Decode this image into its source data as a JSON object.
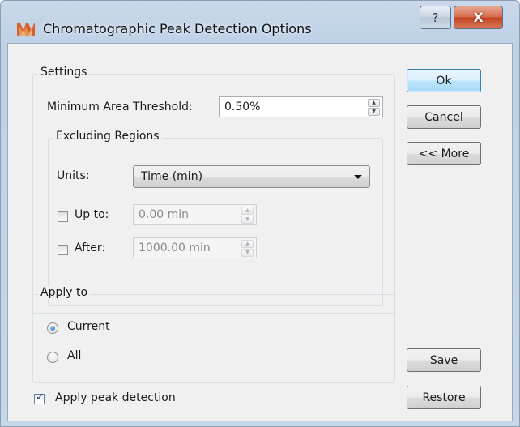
{
  "window": {
    "title": "Chromatographic Peak Detection Options",
    "help_glyph": "?",
    "close_glyph": "X"
  },
  "settings": {
    "group_label": "Settings",
    "min_area_label": "Minimum Area Threshold:",
    "min_area_value": "0.50%",
    "excluding": {
      "group_label": "Excluding Regions",
      "units_label": "Units:",
      "units_value": "Time (min)",
      "up_to": {
        "label": "Up to:",
        "checked": false,
        "value": "0.00 min"
      },
      "after": {
        "label": "After:",
        "checked": false,
        "value": "1000.00 min"
      }
    }
  },
  "apply_to": {
    "group_label": "Apply to",
    "options": [
      {
        "label": "Current",
        "selected": true
      },
      {
        "label": "All",
        "selected": false
      }
    ]
  },
  "apply_peak_detection": {
    "label": "Apply peak detection",
    "checked": true
  },
  "buttons": {
    "ok": "Ok",
    "cancel": "Cancel",
    "more": "<< More",
    "save": "Save",
    "restore": "Restore"
  },
  "colors": {
    "title_gradient": "#c9d8ea",
    "close_button": "#c2421f",
    "default_button_border": "#3c7fb1",
    "client_bg": "#f0f0f0"
  },
  "icons": {
    "app": "app-logo-icon",
    "help": "help-icon",
    "close": "close-icon",
    "spin_up": "spin-up-icon",
    "spin_down": "spin-down-icon",
    "dropdown": "chevron-down-icon",
    "check": "check-icon"
  }
}
